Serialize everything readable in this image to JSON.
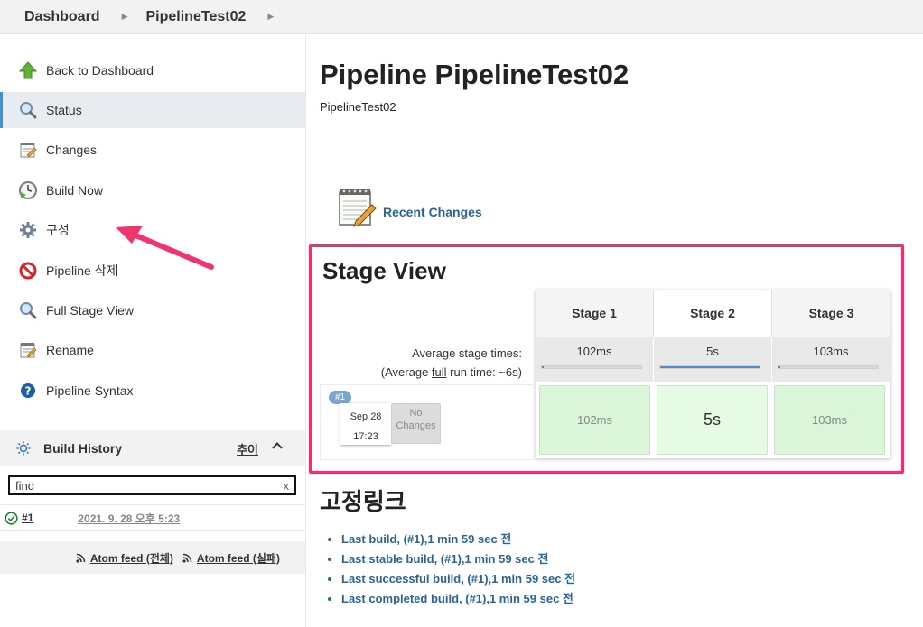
{
  "breadcrumb": {
    "root": "Dashboard",
    "job": "PipelineTest02"
  },
  "sidebar": {
    "tasks": [
      {
        "label": "Back to Dashboard",
        "icon": "up-arrow-icon"
      },
      {
        "label": "Status",
        "icon": "magnifier-icon"
      },
      {
        "label": "Changes",
        "icon": "notepad-icon"
      },
      {
        "label": "Build Now",
        "icon": "clock-play-icon"
      },
      {
        "label": "구성",
        "icon": "gear-icon"
      },
      {
        "label": "Pipeline 삭제",
        "icon": "no-entry-icon"
      },
      {
        "label": "Full Stage View",
        "icon": "magnifier-icon"
      },
      {
        "label": "Rename",
        "icon": "notepad-icon"
      },
      {
        "label": "Pipeline Syntax",
        "icon": "help-icon"
      }
    ],
    "build_history": {
      "title": "Build History",
      "trend": "추이",
      "search_value": "find",
      "clear": "x",
      "builds": [
        {
          "number": "#1",
          "date": "2021. 9. 28 오후 5:23"
        }
      ],
      "feed_all": "Atom feed (전체)",
      "feed_failed": "Atom feed (실패)"
    }
  },
  "main": {
    "title": "Pipeline PipelineTest02",
    "description": "PipelineTest02",
    "recent_changes": "Recent Changes",
    "stage_view": {
      "title": "Stage View",
      "avg_label": "Average stage times:",
      "avg_full_prefix": "(Average ",
      "avg_full_word": "full",
      "avg_full_suffix": " run time: ~6s)",
      "stages": [
        {
          "name": "Stage 1",
          "avg": "102ms",
          "avg_fraction": 0.02,
          "run": "102ms"
        },
        {
          "name": "Stage 2",
          "avg": "5s",
          "avg_fraction": 1.0,
          "run": "5s"
        },
        {
          "name": "Stage 3",
          "avg": "103ms",
          "avg_fraction": 0.02,
          "run": "103ms"
        }
      ],
      "run": {
        "badge": "#1",
        "date": "Sep 28",
        "time": "17:23",
        "no_changes_1": "No",
        "no_changes_2": "Changes"
      }
    },
    "permalinks": {
      "title": "고정링크",
      "links": [
        "Last build, (#1),1 min 59 sec 전",
        "Last stable build, (#1),1 min 59 sec 전",
        "Last successful build, (#1),1 min 59 sec 전",
        "Last completed build, (#1),1 min 59 sec 전"
      ]
    }
  },
  "colors": {
    "accent": "#e8336f",
    "link": "#2a6496",
    "success": "#daf5d8"
  }
}
